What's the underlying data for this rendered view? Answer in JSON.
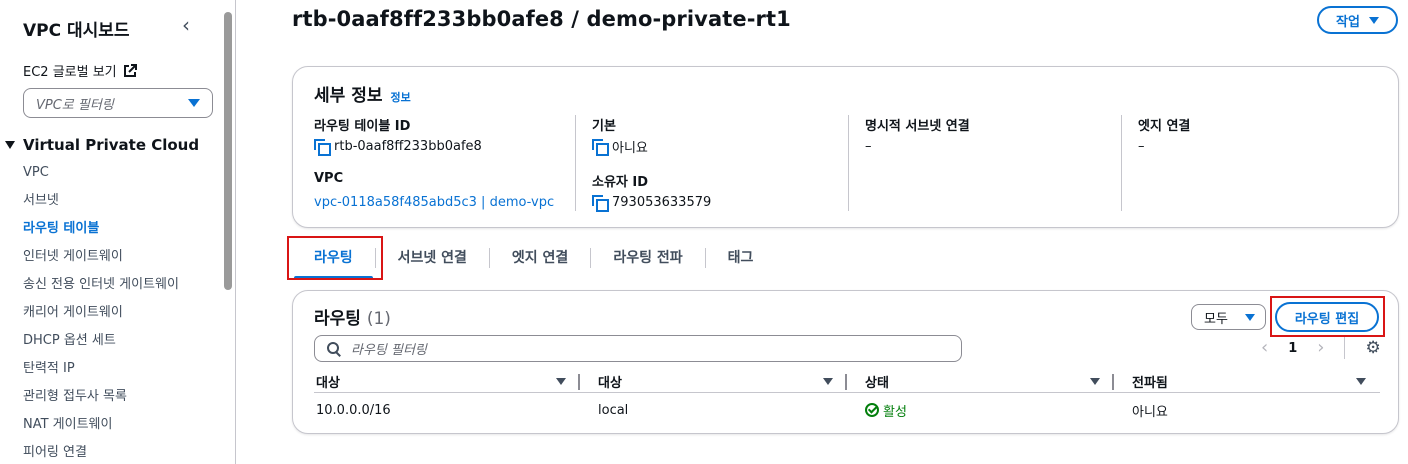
{
  "sidebar": {
    "title": "VPC 대시보드",
    "ec2_link": "EC2 글로벌 보기",
    "filter_placeholder": "VPC로 필터링",
    "section_title": "Virtual Private Cloud",
    "items": [
      {
        "label": "VPC"
      },
      {
        "label": "서브넷"
      },
      {
        "label": "라우팅 테이블"
      },
      {
        "label": "인터넷 게이트웨이"
      },
      {
        "label": "송신 전용 인터넷 게이트웨이"
      },
      {
        "label": "캐리어 게이트웨이"
      },
      {
        "label": "DHCP 옵션 세트"
      },
      {
        "label": "탄력적 IP"
      },
      {
        "label": "관리형 접두사 목록"
      },
      {
        "label": "NAT 게이트웨이"
      },
      {
        "label": "피어링 연결"
      }
    ]
  },
  "header": {
    "title": "rtb-0aaf8ff233bb0afe8 / demo-private-rt1",
    "action_button": "작업"
  },
  "details": {
    "title": "세부 정보",
    "info_link": "정보",
    "fields": {
      "route_table_id": {
        "label": "라우팅 테이블 ID",
        "value": "rtb-0aaf8ff233bb0afe8"
      },
      "vpc": {
        "label": "VPC",
        "value": "vpc-0118a58f485abd5c3 | demo-vpc"
      },
      "main": {
        "label": "기본",
        "value": "아니요"
      },
      "owner_id": {
        "label": "소유자 ID",
        "value": "793053633579"
      },
      "explicit_subnet": {
        "label": "명시적 서브넷 연결",
        "value": "–"
      },
      "edge_association": {
        "label": "엣지 연결",
        "value": "–"
      }
    }
  },
  "tabs": [
    {
      "label": "라우팅"
    },
    {
      "label": "서브넷 연결"
    },
    {
      "label": "엣지 연결"
    },
    {
      "label": "라우팅 전파"
    },
    {
      "label": "태그"
    }
  ],
  "routes": {
    "title": "라우팅",
    "count": "(1)",
    "filter_select": "모두",
    "edit_button": "라우팅 편집",
    "search_placeholder": "라우팅 필터링",
    "page": "1",
    "columns": [
      "대상",
      "대상",
      "상태",
      "전파됨"
    ],
    "rows": [
      {
        "destination": "10.0.0.0/16",
        "target": "local",
        "status": "활성",
        "propagated": "아니요"
      }
    ]
  },
  "colors": {
    "accent": "#0972d3",
    "success": "#037f0c",
    "highlight": "#d91515"
  }
}
